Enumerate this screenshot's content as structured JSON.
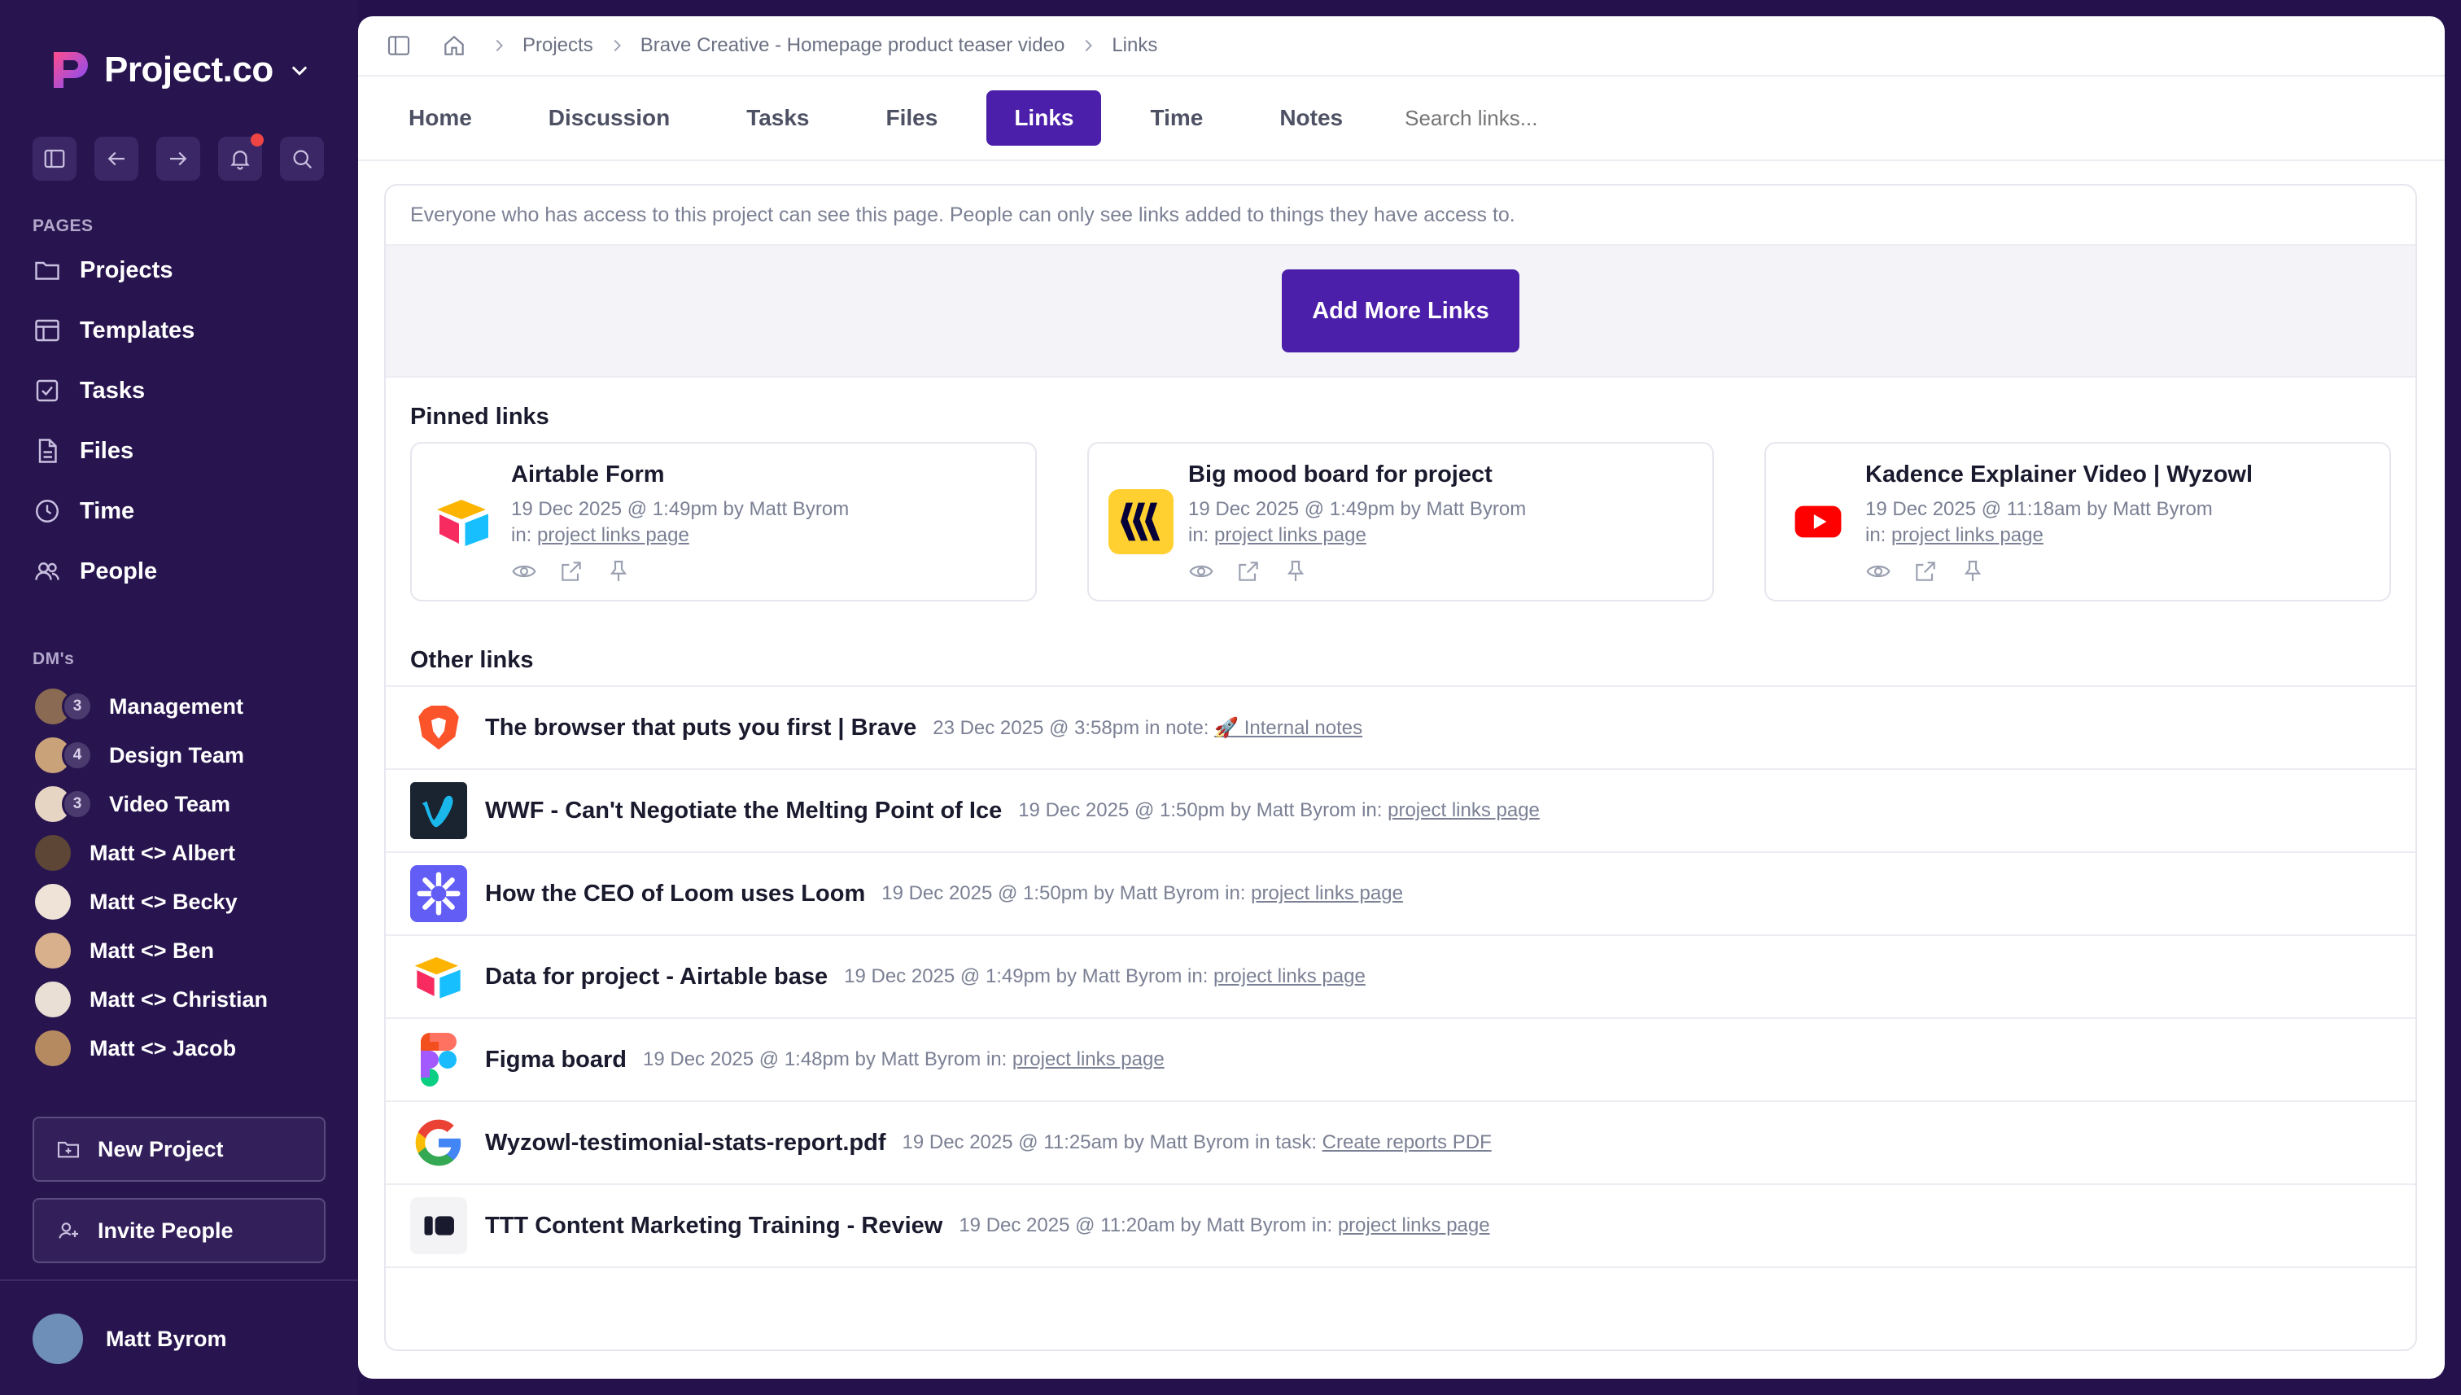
{
  "brand": {
    "name": "Project.co"
  },
  "sidebar": {
    "pages_label": "PAGES",
    "pages": [
      {
        "label": "Projects",
        "icon": "folder-icon"
      },
      {
        "label": "Templates",
        "icon": "template-icon"
      },
      {
        "label": "Tasks",
        "icon": "checkbox-icon"
      },
      {
        "label": "Files",
        "icon": "file-icon"
      },
      {
        "label": "Time",
        "icon": "clock-icon"
      },
      {
        "label": "People",
        "icon": "people-icon"
      }
    ],
    "dms_label": "DM's",
    "dms": [
      {
        "label": "Management",
        "count": "3"
      },
      {
        "label": "Design Team",
        "count": "4"
      },
      {
        "label": "Video Team",
        "count": "3"
      },
      {
        "label": "Matt <> Albert"
      },
      {
        "label": "Matt <> Becky"
      },
      {
        "label": "Matt <> Ben"
      },
      {
        "label": "Matt <> Christian"
      },
      {
        "label": "Matt <> Jacob"
      }
    ],
    "new_project": "New Project",
    "invite_people": "Invite People",
    "user_name": "Matt Byrom"
  },
  "breadcrumb": [
    "Projects",
    "Brave Creative - Homepage product teaser video",
    "Links"
  ],
  "tabs": [
    {
      "label": "Home"
    },
    {
      "label": "Discussion"
    },
    {
      "label": "Tasks"
    },
    {
      "label": "Files"
    },
    {
      "label": "Links",
      "active": true
    },
    {
      "label": "Time"
    },
    {
      "label": "Notes"
    }
  ],
  "search": {
    "placeholder": "Search links..."
  },
  "notice": "Everyone who has access to this project can see this page. People can only see links added to things they have access to.",
  "add_button": "Add More Links",
  "pinned": {
    "title": "Pinned links",
    "items": [
      {
        "title": "Airtable Form",
        "meta": "19 Dec 2025 @ 1:49pm by Matt Byrom",
        "in_prefix": "in:",
        "in_link": "project links page",
        "icon": "airtable-icon"
      },
      {
        "title": "Big mood board for project",
        "meta": "19 Dec 2025 @ 1:49pm by Matt Byrom",
        "in_prefix": "in:",
        "in_link": "project links page",
        "icon": "miro-icon"
      },
      {
        "title": "Kadence Explainer Video | Wyzowl",
        "meta": "19 Dec 2025 @ 11:18am by Matt Byrom",
        "in_prefix": "in:",
        "in_link": "project links page",
        "icon": "youtube-icon"
      }
    ]
  },
  "other": {
    "title": "Other links",
    "items": [
      {
        "title": "The browser that puts you first | Brave",
        "meta": "23 Dec 2025 @ 3:58pm in note:",
        "link": "🚀 Internal notes",
        "icon": "brave-icon"
      },
      {
        "title": "WWF - Can't Negotiate the Melting Point of Ice",
        "meta": "19 Dec 2025 @ 1:50pm by Matt Byrom in:",
        "link": "project links page",
        "icon": "vimeo-icon"
      },
      {
        "title": "How the CEO of Loom uses Loom",
        "meta": "19 Dec 2025 @ 1:50pm by Matt Byrom in:",
        "link": "project links page",
        "icon": "loom-icon"
      },
      {
        "title": "Data for project - Airtable base",
        "meta": "19 Dec 2025 @ 1:49pm by Matt Byrom in:",
        "link": "project links page",
        "icon": "airtable-icon"
      },
      {
        "title": "Figma board",
        "meta": "19 Dec 2025 @ 1:48pm by Matt Byrom in:",
        "link": "project links page",
        "icon": "figma-icon"
      },
      {
        "title": "Wyzowl-testimonial-stats-report.pdf",
        "meta": "19 Dec 2025 @ 11:25am by Matt Byrom in task:",
        "link": "Create reports PDF",
        "icon": "google-icon"
      },
      {
        "title": "TTT Content Marketing Training - Review",
        "meta": "19 Dec 2025 @ 11:20am by Matt Byrom in:",
        "link": "project links page",
        "icon": "pitch-icon"
      }
    ]
  },
  "colors": {
    "accent": "#4b1fa9",
    "sidebar_bg": "#28154f",
    "notification": "#ef4444"
  }
}
